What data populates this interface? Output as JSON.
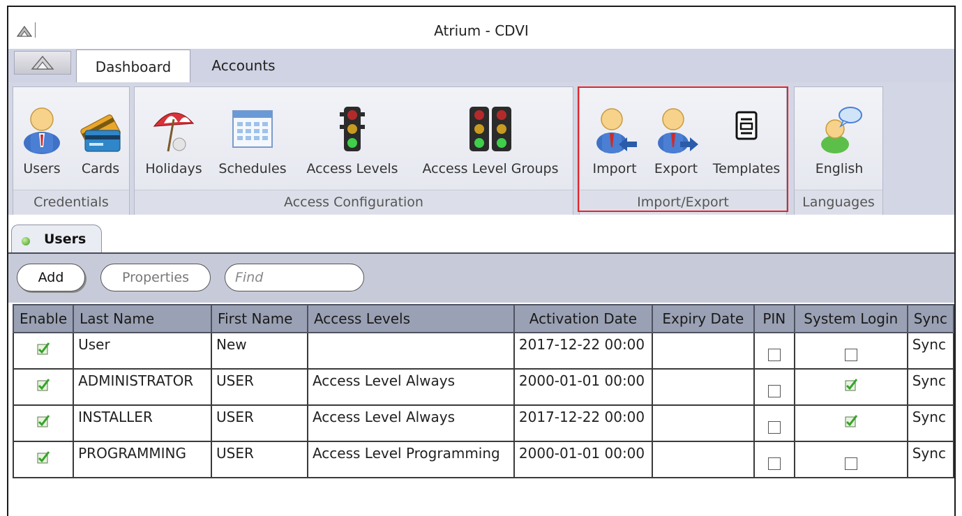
{
  "window": {
    "title": "Atrium - CDVI"
  },
  "tabs": [
    {
      "label": "Dashboard",
      "active": true
    },
    {
      "label": "Accounts",
      "active": false
    }
  ],
  "ribbon": {
    "credentials": {
      "label": "Credentials",
      "users": "Users",
      "cards": "Cards"
    },
    "access_configuration": {
      "label": "Access Configuration",
      "holidays": "Holidays",
      "schedules": "Schedules",
      "access_levels": "Access Levels",
      "access_level_groups": "Access Level Groups"
    },
    "import_export": {
      "label": "Import/Export",
      "import": "Import",
      "export": "Export",
      "templates": "Templates"
    },
    "languages": {
      "label": "Languages",
      "english": "English"
    }
  },
  "document_tab": {
    "label": "Users",
    "status_color": "#3a9a20"
  },
  "toolbar": {
    "add": "Add",
    "properties": "Properties",
    "find_placeholder": "Find"
  },
  "grid": {
    "columns": [
      "Enable",
      "Last Name",
      "First Name",
      "Access Levels",
      "Activation Date",
      "Expiry Date",
      "PIN",
      "System Login",
      "Sync"
    ],
    "rows": [
      {
        "enable": true,
        "last_name": "User",
        "first_name": "New",
        "access_levels": "",
        "activation_date": "2017-12-22 00:00",
        "expiry_date": "",
        "pin": false,
        "system_login": false,
        "sync": "Sync"
      },
      {
        "enable": true,
        "last_name": "ADMINISTRATOR",
        "first_name": "USER",
        "access_levels": "Access Level Always",
        "activation_date": "2000-01-01 00:00",
        "expiry_date": "",
        "pin": false,
        "system_login": true,
        "sync": "Sync"
      },
      {
        "enable": true,
        "last_name": "INSTALLER",
        "first_name": "USER",
        "access_levels": "Access Level Always",
        "activation_date": "2017-12-22 00:00",
        "expiry_date": "",
        "pin": false,
        "system_login": true,
        "sync": "Sync"
      },
      {
        "enable": true,
        "last_name": "PROGRAMMING",
        "first_name": "USER",
        "access_levels": "Access Level Programming",
        "activation_date": "2000-01-01 00:00",
        "expiry_date": "",
        "pin": false,
        "system_login": false,
        "sync": "Sync"
      }
    ]
  },
  "colors": {
    "highlight": "#e0262a",
    "header_bg": "#9aa1b4",
    "ribbon_bg": "#d3d6e4"
  }
}
